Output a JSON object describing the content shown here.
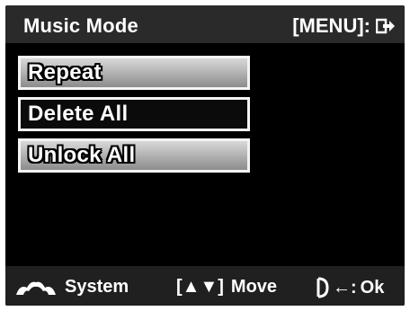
{
  "header": {
    "title": "Music Mode",
    "menu_hint": "[MENU]:",
    "menu_hint_icon": "exit-arrow-icon"
  },
  "menu": {
    "items": [
      {
        "label": "Repeat",
        "state": "normal"
      },
      {
        "label": "Delete All",
        "state": "selected"
      },
      {
        "label": "Unlock All",
        "state": "normal"
      }
    ]
  },
  "footer": {
    "system_label": "System",
    "system_icon": "mode-dial-icon",
    "move_label": "Move",
    "move_keys": "[▲▼]",
    "ok_label": "Ok",
    "ok_icon": "shutter-half-press-icon",
    "ok_arrow": "←:"
  },
  "colors": {
    "screen_bg": "#000000",
    "text": "#ffffff",
    "item_border": "#f4f4f4",
    "item_gradient_top": "#d8d8d8",
    "item_gradient_bottom": "#8c8c8c"
  }
}
